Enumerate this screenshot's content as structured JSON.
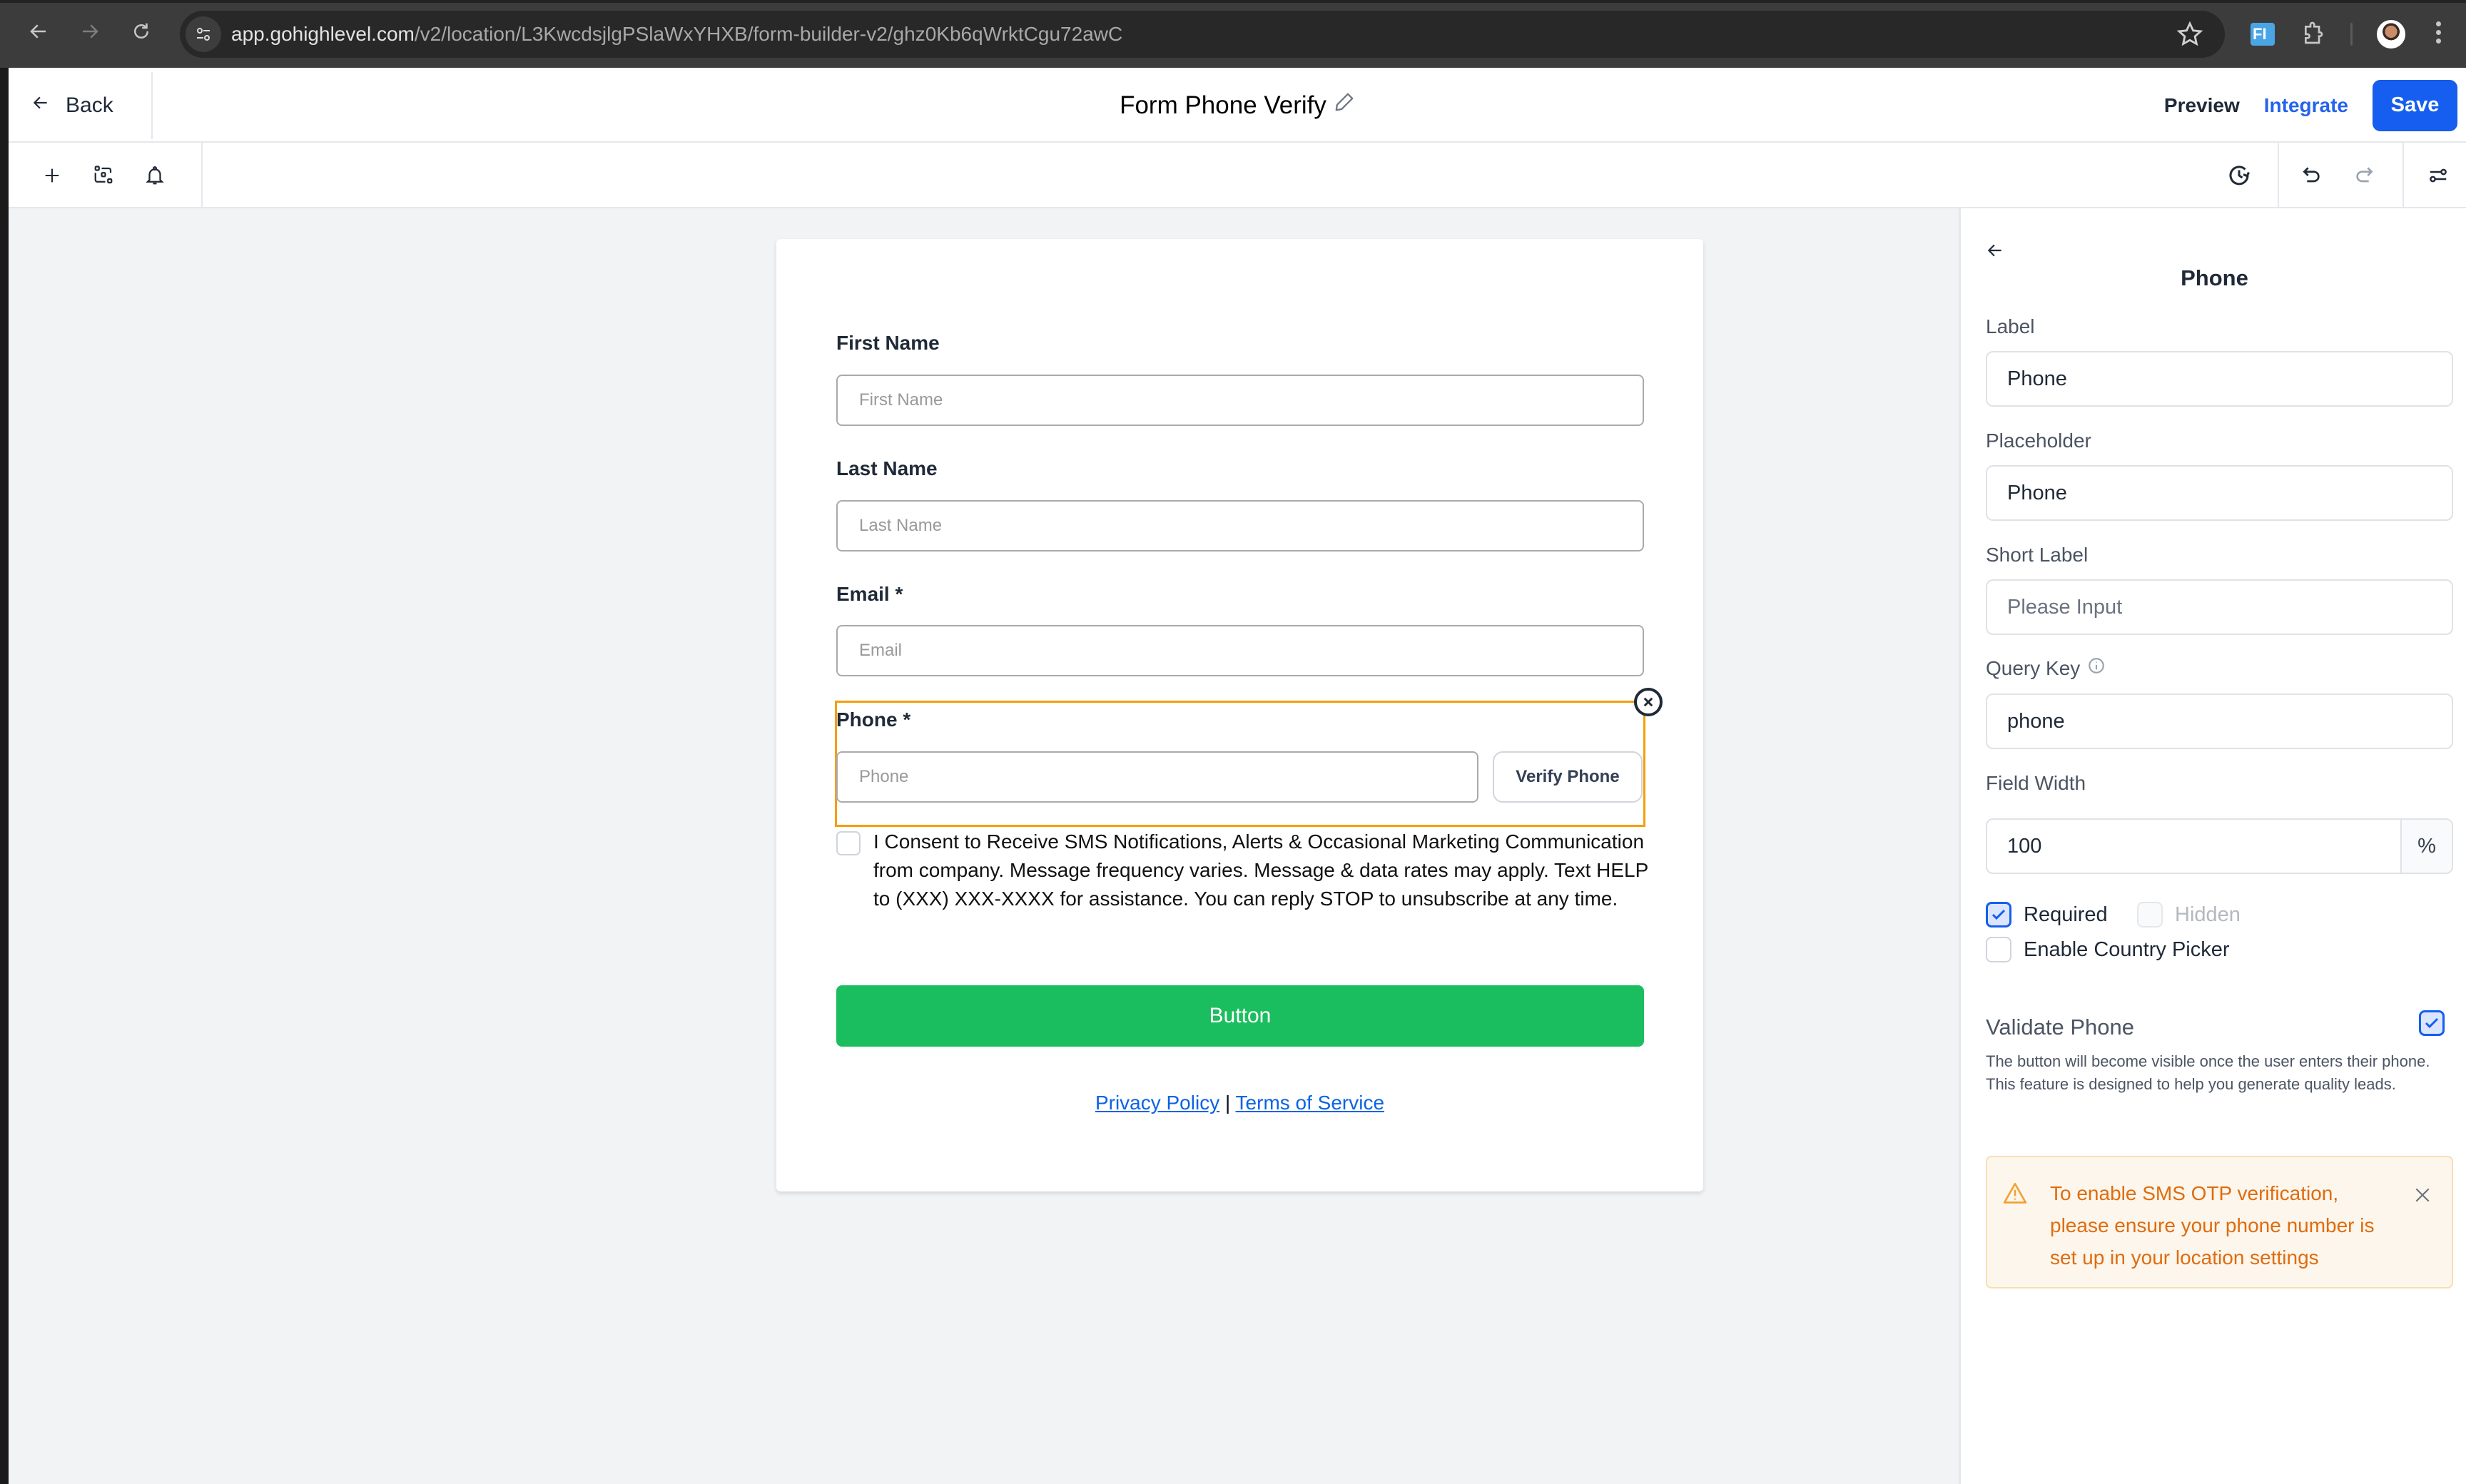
{
  "browser": {
    "url_domain": "app.gohighlevel.com",
    "url_path": "/v2/location/L3KwcdsjlgPSlaWxYHXB/form-builder-v2/ghz0Kb6qWrktCgu72awC",
    "extension_label": "FI"
  },
  "header": {
    "back_label": "Back",
    "form_title": "Form Phone Verify",
    "preview_label": "Preview",
    "integrate_label": "Integrate",
    "save_label": "Save"
  },
  "colors": {
    "primary": "#155eef",
    "submit_green": "#1bbe5e",
    "selection_orange": "#f59e0b",
    "warning_text": "#df6c0f",
    "link_blue": "#0b63e5"
  },
  "form": {
    "fields": [
      {
        "label": "First Name",
        "placeholder": "First Name"
      },
      {
        "label": "Last Name",
        "placeholder": "Last Name"
      },
      {
        "label": "Email *",
        "placeholder": "Email"
      },
      {
        "label": "Phone *",
        "placeholder": "Phone"
      }
    ],
    "verify_button": "Verify Phone",
    "consent_text": "I Consent to Receive SMS Notifications, Alerts & Occasional Marketing Communication from company. Message frequency varies. Message & data rates may apply. Text HELP to (XXX) XXX-XXXX for assistance. You can reply STOP to unsubscribe at any time.",
    "consent_checked": false,
    "submit_label": "Button",
    "privacy_label": "Privacy Policy",
    "separator": "|",
    "terms_label": "Terms of Service"
  },
  "panel": {
    "title": "Phone",
    "label_label": "Label",
    "label_value": "Phone",
    "placeholder_label": "Placeholder",
    "placeholder_value": "Phone",
    "short_label_label": "Short Label",
    "short_label_placeholder": "Please Input",
    "query_key_label": "Query Key",
    "query_key_value": "phone",
    "field_width_label": "Field Width",
    "field_width_value": "100",
    "field_width_unit": "%",
    "required_label": "Required",
    "required_checked": true,
    "hidden_label": "Hidden",
    "hidden_checked": false,
    "country_picker_label": "Enable Country Picker",
    "country_picker_checked": false,
    "validate_phone_label": "Validate Phone",
    "validate_phone_checked": true,
    "validate_phone_desc": "The button will become visible once the user enters their phone. This feature is designed to help you generate quality leads.",
    "alert_text": "To enable SMS OTP verification, please ensure your phone number is set up in your location settings"
  }
}
